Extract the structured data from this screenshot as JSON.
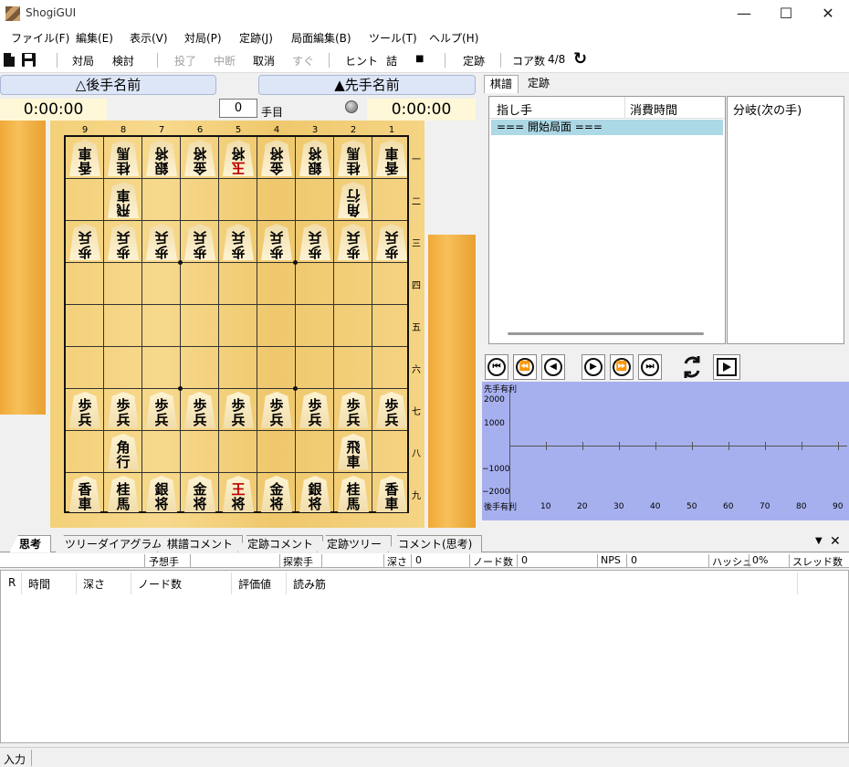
{
  "window": {
    "title": "ShogiGUI",
    "minimize": "—",
    "maximize": "☐",
    "close": "✕"
  },
  "menu": [
    "ファイル(F)",
    "編集(E)",
    "表示(V)",
    "対局(P)",
    "定跡(J)",
    "局面編集(B)",
    "ツール(T)",
    "ヘルプ(H)"
  ],
  "toolbar": {
    "new_icon": "new-file-icon",
    "save_icon": "save-icon",
    "play": "対局",
    "analyze": "検討",
    "resign": "投了",
    "interrupt": "中断",
    "undo": "取消",
    "now": "すぐ",
    "hint": "ヒント",
    "mate": "詰",
    "stop": "■",
    "joseki": "定跡",
    "cores_label": "コア数",
    "cores_value": "4/8",
    "refresh": "↻"
  },
  "players": {
    "gote": "△後手名前",
    "sente": "▲先手名前"
  },
  "clocks": {
    "gote": "0:00:00",
    "sente": "0:00:00"
  },
  "move": {
    "count": "0",
    "label": "手目"
  },
  "board": {
    "files": [
      "9",
      "8",
      "7",
      "6",
      "5",
      "4",
      "3",
      "2",
      "1"
    ],
    "ranks": [
      "一",
      "二",
      "三",
      "四",
      "五",
      "六",
      "七",
      "八",
      "九"
    ],
    "gote_back": [
      [
        "香",
        "車"
      ],
      [
        "桂",
        "馬"
      ],
      [
        "銀",
        "将"
      ],
      [
        "金",
        "将"
      ],
      [
        "玉",
        "将"
      ],
      [
        "金",
        "将"
      ],
      [
        "銀",
        "将"
      ],
      [
        "桂",
        "馬"
      ],
      [
        "香",
        "車"
      ]
    ],
    "gote_rook": [
      "飛",
      "車"
    ],
    "gote_bishop": [
      "角",
      "行"
    ],
    "pawn": [
      "歩",
      "兵"
    ],
    "sente_rook": [
      "飛",
      "車"
    ],
    "sente_bishop": [
      "角",
      "行"
    ],
    "sente_back": [
      [
        "香",
        "車"
      ],
      [
        "桂",
        "馬"
      ],
      [
        "銀",
        "将"
      ],
      [
        "金",
        "将"
      ],
      [
        "王",
        "将"
      ],
      [
        "金",
        "将"
      ],
      [
        "銀",
        "将"
      ],
      [
        "桂",
        "馬"
      ],
      [
        "香",
        "車"
      ]
    ]
  },
  "right_tabs": [
    "棋譜",
    "定跡"
  ],
  "kifu": {
    "col_move": "指し手",
    "col_time": "消費時間",
    "row0": "=== 開始局面 ===",
    "branch_head": "分岐(次の手)"
  },
  "nav": [
    "⏮",
    "⏪",
    "◀",
    "▶",
    "⏩",
    "⏭"
  ],
  "graph": {
    "top_label": "先手有利",
    "bottom_label": "後手有利",
    "y_ticks": [
      "2000",
      "1000",
      "−1000",
      "−2000"
    ],
    "x_ticks": [
      "10",
      "20",
      "30",
      "40",
      "50",
      "60",
      "70",
      "80",
      "90"
    ]
  },
  "bottom_tabs": [
    "思考",
    "ツリーダイアグラム",
    "棋譜コメント",
    "定跡コメント",
    "定跡ツリー",
    "コメント(思考)"
  ],
  "stats": {
    "predict": "予想手",
    "search": "探索手",
    "depth": "深さ",
    "depth_val": "0",
    "nodes": "ノード数",
    "nodes_val": "0",
    "nps": "NPS",
    "nps_val": "0",
    "hash": "ハッシュ",
    "hash_val": "0%",
    "threads": "スレッド数"
  },
  "think_cols": [
    "R",
    "時間",
    "深さ",
    "ノード数",
    "評価値",
    "読み筋"
  ],
  "input_label": "入力",
  "colors": {
    "graph_bg": "#a7b0ee",
    "kifu_highlight": "#add8e6",
    "clock_bg": "#fff8d8"
  }
}
